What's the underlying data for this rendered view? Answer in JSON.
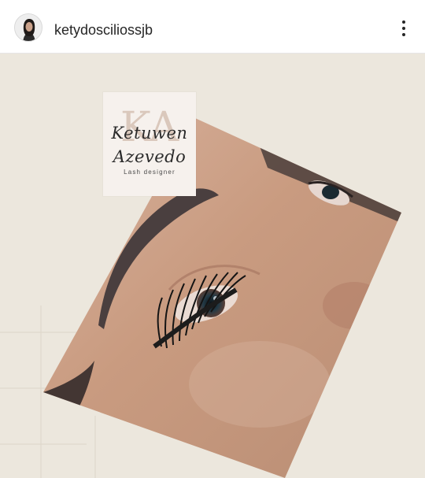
{
  "post": {
    "username": "ketydosciliossjb",
    "avatar": "profile-photo",
    "more_icon": "more-vertical-icon"
  },
  "image": {
    "logo": {
      "monogram": "KA",
      "name_line1": "Ketuwen",
      "name_line2": "Azevedo",
      "tagline": "Lash designer"
    },
    "colors": {
      "background": "#ece7dd",
      "logo_card": "#f6f1ed",
      "skin": "#c79a7f"
    }
  }
}
